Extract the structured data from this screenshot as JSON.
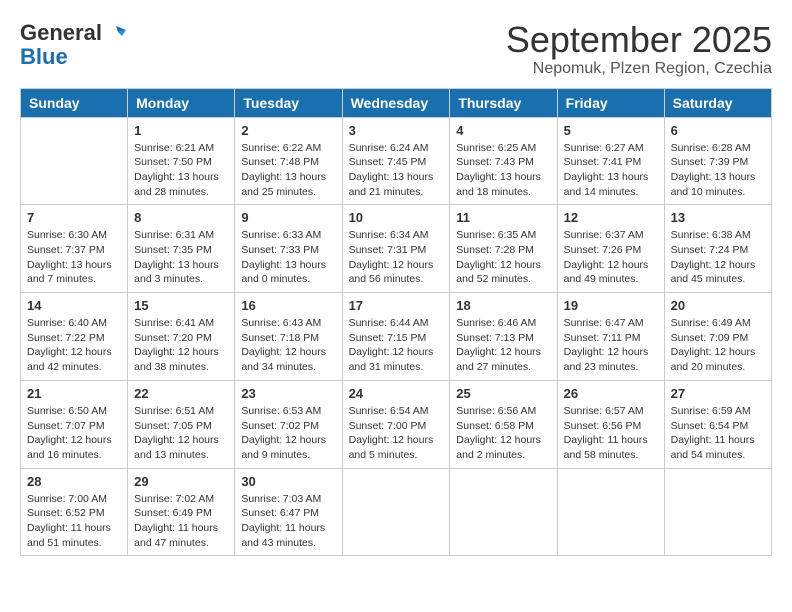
{
  "header": {
    "logo_line1": "General",
    "logo_line2": "Blue",
    "month": "September 2025",
    "location": "Nepomuk, Plzen Region, Czechia"
  },
  "weekdays": [
    "Sunday",
    "Monday",
    "Tuesday",
    "Wednesday",
    "Thursday",
    "Friday",
    "Saturday"
  ],
  "weeks": [
    [
      {
        "day": "",
        "info": ""
      },
      {
        "day": "1",
        "info": "Sunrise: 6:21 AM\nSunset: 7:50 PM\nDaylight: 13 hours\nand 28 minutes."
      },
      {
        "day": "2",
        "info": "Sunrise: 6:22 AM\nSunset: 7:48 PM\nDaylight: 13 hours\nand 25 minutes."
      },
      {
        "day": "3",
        "info": "Sunrise: 6:24 AM\nSunset: 7:45 PM\nDaylight: 13 hours\nand 21 minutes."
      },
      {
        "day": "4",
        "info": "Sunrise: 6:25 AM\nSunset: 7:43 PM\nDaylight: 13 hours\nand 18 minutes."
      },
      {
        "day": "5",
        "info": "Sunrise: 6:27 AM\nSunset: 7:41 PM\nDaylight: 13 hours\nand 14 minutes."
      },
      {
        "day": "6",
        "info": "Sunrise: 6:28 AM\nSunset: 7:39 PM\nDaylight: 13 hours\nand 10 minutes."
      }
    ],
    [
      {
        "day": "7",
        "info": "Sunrise: 6:30 AM\nSunset: 7:37 PM\nDaylight: 13 hours\nand 7 minutes."
      },
      {
        "day": "8",
        "info": "Sunrise: 6:31 AM\nSunset: 7:35 PM\nDaylight: 13 hours\nand 3 minutes."
      },
      {
        "day": "9",
        "info": "Sunrise: 6:33 AM\nSunset: 7:33 PM\nDaylight: 13 hours\nand 0 minutes."
      },
      {
        "day": "10",
        "info": "Sunrise: 6:34 AM\nSunset: 7:31 PM\nDaylight: 12 hours\nand 56 minutes."
      },
      {
        "day": "11",
        "info": "Sunrise: 6:35 AM\nSunset: 7:28 PM\nDaylight: 12 hours\nand 52 minutes."
      },
      {
        "day": "12",
        "info": "Sunrise: 6:37 AM\nSunset: 7:26 PM\nDaylight: 12 hours\nand 49 minutes."
      },
      {
        "day": "13",
        "info": "Sunrise: 6:38 AM\nSunset: 7:24 PM\nDaylight: 12 hours\nand 45 minutes."
      }
    ],
    [
      {
        "day": "14",
        "info": "Sunrise: 6:40 AM\nSunset: 7:22 PM\nDaylight: 12 hours\nand 42 minutes."
      },
      {
        "day": "15",
        "info": "Sunrise: 6:41 AM\nSunset: 7:20 PM\nDaylight: 12 hours\nand 38 minutes."
      },
      {
        "day": "16",
        "info": "Sunrise: 6:43 AM\nSunset: 7:18 PM\nDaylight: 12 hours\nand 34 minutes."
      },
      {
        "day": "17",
        "info": "Sunrise: 6:44 AM\nSunset: 7:15 PM\nDaylight: 12 hours\nand 31 minutes."
      },
      {
        "day": "18",
        "info": "Sunrise: 6:46 AM\nSunset: 7:13 PM\nDaylight: 12 hours\nand 27 minutes."
      },
      {
        "day": "19",
        "info": "Sunrise: 6:47 AM\nSunset: 7:11 PM\nDaylight: 12 hours\nand 23 minutes."
      },
      {
        "day": "20",
        "info": "Sunrise: 6:49 AM\nSunset: 7:09 PM\nDaylight: 12 hours\nand 20 minutes."
      }
    ],
    [
      {
        "day": "21",
        "info": "Sunrise: 6:50 AM\nSunset: 7:07 PM\nDaylight: 12 hours\nand 16 minutes."
      },
      {
        "day": "22",
        "info": "Sunrise: 6:51 AM\nSunset: 7:05 PM\nDaylight: 12 hours\nand 13 minutes."
      },
      {
        "day": "23",
        "info": "Sunrise: 6:53 AM\nSunset: 7:02 PM\nDaylight: 12 hours\nand 9 minutes."
      },
      {
        "day": "24",
        "info": "Sunrise: 6:54 AM\nSunset: 7:00 PM\nDaylight: 12 hours\nand 5 minutes."
      },
      {
        "day": "25",
        "info": "Sunrise: 6:56 AM\nSunset: 6:58 PM\nDaylight: 12 hours\nand 2 minutes."
      },
      {
        "day": "26",
        "info": "Sunrise: 6:57 AM\nSunset: 6:56 PM\nDaylight: 11 hours\nand 58 minutes."
      },
      {
        "day": "27",
        "info": "Sunrise: 6:59 AM\nSunset: 6:54 PM\nDaylight: 11 hours\nand 54 minutes."
      }
    ],
    [
      {
        "day": "28",
        "info": "Sunrise: 7:00 AM\nSunset: 6:52 PM\nDaylight: 11 hours\nand 51 minutes."
      },
      {
        "day": "29",
        "info": "Sunrise: 7:02 AM\nSunset: 6:49 PM\nDaylight: 11 hours\nand 47 minutes."
      },
      {
        "day": "30",
        "info": "Sunrise: 7:03 AM\nSunset: 6:47 PM\nDaylight: 11 hours\nand 43 minutes."
      },
      {
        "day": "",
        "info": ""
      },
      {
        "day": "",
        "info": ""
      },
      {
        "day": "",
        "info": ""
      },
      {
        "day": "",
        "info": ""
      }
    ]
  ]
}
